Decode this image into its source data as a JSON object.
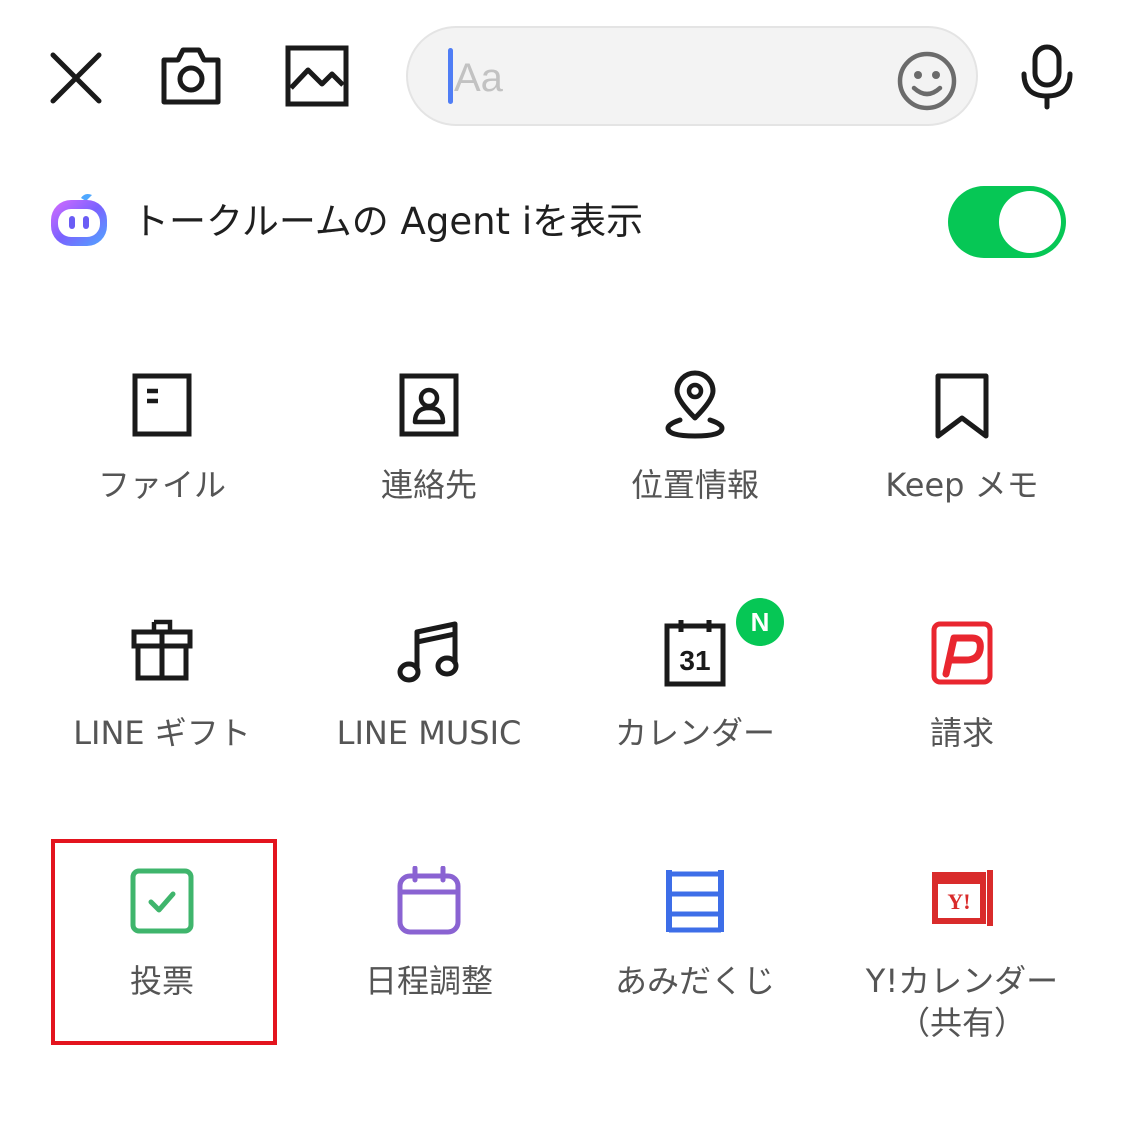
{
  "toolbar": {
    "search_placeholder": "Aa",
    "icons": [
      "close-icon",
      "camera-icon",
      "image-icon",
      "emoji-icon",
      "microphone-icon"
    ]
  },
  "agent": {
    "label": "トークルームの Agent iを表示",
    "toggle_on": true,
    "icon": "agent-i-icon"
  },
  "menu": {
    "items": [
      {
        "label": "ファイル",
        "icon": "file-icon"
      },
      {
        "label": "連絡先",
        "icon": "contact-icon"
      },
      {
        "label": "位置情報",
        "icon": "location-pin-icon"
      },
      {
        "label": "Keep メモ",
        "icon": "bookmark-icon"
      },
      {
        "label": "LINE ギフト",
        "icon": "gift-icon"
      },
      {
        "label": "LINE MUSIC",
        "icon": "music-note-icon"
      },
      {
        "label": "カレンダー",
        "icon": "calendar-icon",
        "calendar_day": "31",
        "badge": "N"
      },
      {
        "label": "請求",
        "icon": "paypay-icon"
      },
      {
        "label": "投票",
        "icon": "vote-checkbox-icon"
      },
      {
        "label": "日程調整",
        "icon": "schedule-calendar-icon"
      },
      {
        "label": "あみだくじ",
        "icon": "ladder-icon"
      },
      {
        "label": "Y!カレンダー",
        "sublabel": "（共有）",
        "icon": "yahoo-calendar-icon",
        "logo_text": "Y!"
      }
    ]
  },
  "colors": {
    "accent_green": "#06c755",
    "highlight_red": "#e3141e",
    "vote_green": "#3fb56c",
    "schedule_purple": "#8a63d2",
    "ladder_blue": "#3d6ee8",
    "paypay_red": "#e9262f"
  }
}
